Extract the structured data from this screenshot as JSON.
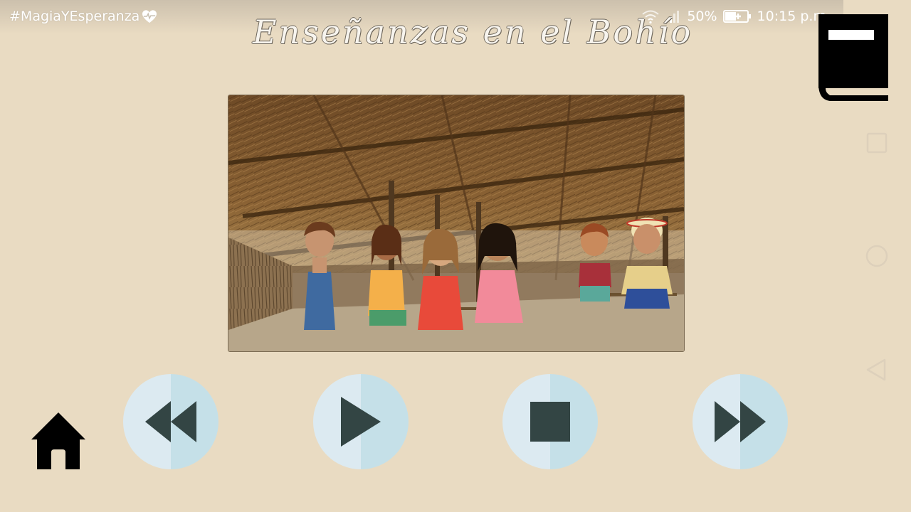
{
  "status_bar": {
    "hashtag": "#MagiaYEsperanza",
    "battery": "50%",
    "time": "10:15 p.m."
  },
  "app": {
    "title": "Enseñanzas en el Bohío"
  },
  "controls": {
    "rewind_icon": "rewind-icon",
    "play_icon": "play-icon",
    "stop_icon": "stop-icon",
    "fast_forward_icon": "fast-forward-icon",
    "home_icon": "home-icon",
    "book_icon": "book-icon"
  },
  "colors": {
    "background": "#e9dbc2",
    "control_light": "#dceaf1",
    "control_dark": "#c5e0e8",
    "control_icon": "#334544"
  }
}
